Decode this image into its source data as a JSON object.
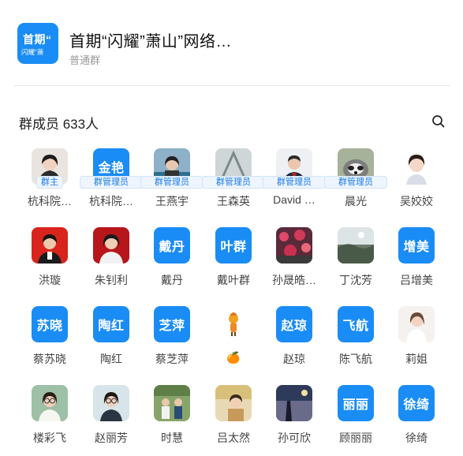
{
  "header": {
    "avatar_line1": "首期“",
    "avatar_line2": "闪耀”萧",
    "group_name": "首期“闪耀”萧山”网络…",
    "group_type": "普通群"
  },
  "members": {
    "title": "群成员 633人",
    "search_icon": "search-icon",
    "list": [
      {
        "name": "杭科院…",
        "badge": "群主",
        "avatar": "photo"
      },
      {
        "name": "杭科院…",
        "badge": "群管理员",
        "avatar_text": "金艳"
      },
      {
        "name": "王燕宇",
        "badge": "群管理员",
        "avatar": "photo"
      },
      {
        "name": "王森英",
        "badge": "群管理员",
        "avatar": "photo"
      },
      {
        "name": "David …",
        "badge": "群管理员",
        "avatar": "photo"
      },
      {
        "name": "晨光",
        "badge": "群管理员",
        "avatar": "photo"
      },
      {
        "name": "吴姣姣",
        "avatar": "photo"
      },
      {
        "name": "洪璇",
        "avatar": "photo"
      },
      {
        "name": "朱钊利",
        "avatar": "photo"
      },
      {
        "name": "戴丹",
        "avatar_text": "戴丹"
      },
      {
        "name": "戴叶群",
        "avatar_text": "叶群"
      },
      {
        "name": "孙晟皓…",
        "avatar": "photo"
      },
      {
        "name": "丁沈芳",
        "avatar": "photo"
      },
      {
        "name": "吕增美",
        "avatar_text": "增美"
      },
      {
        "name": "蔡苏晓",
        "avatar_text": "苏晓"
      },
      {
        "name": "陶红",
        "avatar_text": "陶红"
      },
      {
        "name": "蔡芝萍",
        "avatar_text": "芝萍"
      },
      {
        "name": "🍊",
        "avatar": "photo"
      },
      {
        "name": "赵琼",
        "avatar_text": "赵琼"
      },
      {
        "name": "陈飞航",
        "avatar_text": "飞航"
      },
      {
        "name": "莉姐",
        "avatar": "photo"
      },
      {
        "name": "楼彩飞",
        "avatar": "photo"
      },
      {
        "name": "赵丽芳",
        "avatar": "photo"
      },
      {
        "name": "时慧",
        "avatar": "photo"
      },
      {
        "name": "吕太然",
        "avatar": "photo"
      },
      {
        "name": "孙可欣",
        "avatar": "photo"
      },
      {
        "name": "顾丽丽",
        "avatar_text": "丽丽"
      },
      {
        "name": "徐绮",
        "avatar_text": "徐绮"
      }
    ]
  }
}
